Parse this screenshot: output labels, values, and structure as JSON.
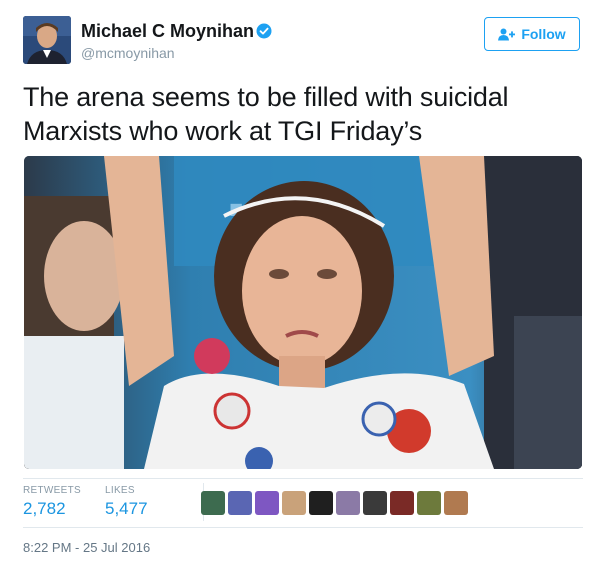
{
  "author": {
    "display_name": "Michael C Moynihan",
    "handle": "@mcmoynihan",
    "verified": true,
    "avatar_icon": "profile-photo"
  },
  "follow_button": {
    "label": "Follow",
    "icon": "add-user-icon"
  },
  "tweet": {
    "text": "The arena seems to be filled with suicidal Marxists who work at TGI Friday’s",
    "media": {
      "kind": "photo"
    }
  },
  "stats": {
    "retweets_label": "RETWEETS",
    "retweets_value": "2,782",
    "likes_label": "LIKES",
    "likes_value": "5,477"
  },
  "likers": [
    {
      "color": "#3d6b4f"
    },
    {
      "color": "#5a66b3"
    },
    {
      "color": "#7e57c2"
    },
    {
      "color": "#c9a27a"
    },
    {
      "color": "#1f1f1f"
    },
    {
      "color": "#8b7aa6"
    },
    {
      "color": "#3a3a3a"
    },
    {
      "color": "#7a2a26"
    },
    {
      "color": "#6d7a3c"
    },
    {
      "color": "#b07a50"
    }
  ],
  "timestamp": "8:22 PM - 25 Jul 2016",
  "colors": {
    "accent": "#1da1f2",
    "link": "#1b95e0",
    "muted": "#8899a6",
    "text": "#14171a"
  }
}
